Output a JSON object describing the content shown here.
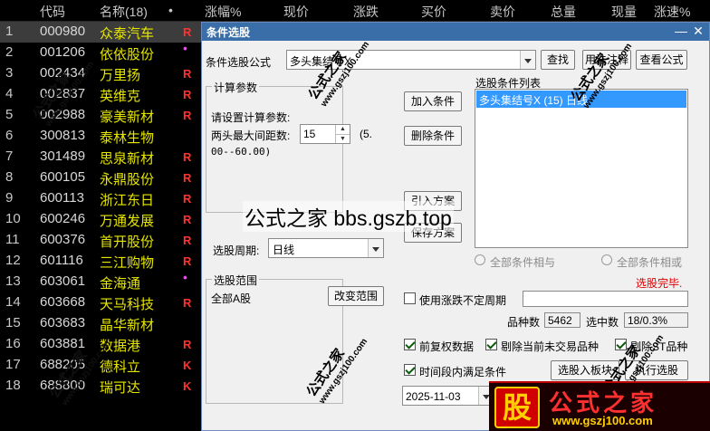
{
  "grid": {
    "headers": [
      "代码",
      "名称(18)",
      "•",
      "涨幅%",
      "现价",
      "涨跌",
      "买价",
      "卖价",
      "总量",
      "现量",
      "涨速%"
    ],
    "rows": [
      {
        "no": "1",
        "code": "000980",
        "name": "众泰汽车",
        "flag": "R"
      },
      {
        "no": "2",
        "code": "001206",
        "name": "依依股份",
        "flag": "•"
      },
      {
        "no": "3",
        "code": "002434",
        "name": "万里扬",
        "flag": "R"
      },
      {
        "no": "4",
        "code": "002837",
        "name": "英维克",
        "flag": "R"
      },
      {
        "no": "5",
        "code": "002988",
        "name": "豪美新材",
        "flag": "R"
      },
      {
        "no": "6",
        "code": "300813",
        "name": "泰林生物",
        "flag": ""
      },
      {
        "no": "7",
        "code": "301489",
        "name": "思泉新材",
        "flag": "R"
      },
      {
        "no": "8",
        "code": "600105",
        "name": "永鼎股份",
        "flag": "R"
      },
      {
        "no": "9",
        "code": "600113",
        "name": "浙江东日",
        "flag": "R"
      },
      {
        "no": "10",
        "code": "600246",
        "name": "万通发展",
        "flag": "R"
      },
      {
        "no": "11",
        "code": "600376",
        "name": "首开股份",
        "flag": "R"
      },
      {
        "no": "12",
        "code": "601116",
        "name": "三江购物",
        "flag": "R"
      },
      {
        "no": "13",
        "code": "603061",
        "name": "金海通",
        "flag": "•"
      },
      {
        "no": "14",
        "code": "603668",
        "name": "天马科技",
        "flag": "R"
      },
      {
        "no": "15",
        "code": "603683",
        "name": "晶华新材",
        "flag": ""
      },
      {
        "no": "16",
        "code": "603881",
        "name": "数据港",
        "flag": "R"
      },
      {
        "no": "17",
        "code": "688205",
        "name": "德科立",
        "flag": "K"
      },
      {
        "no": "18",
        "code": "688800",
        "name": "瑞可达",
        "flag": "K"
      }
    ]
  },
  "dialog": {
    "title": "条件选股",
    "formula_label": "条件选股公式",
    "formula_value": "多头集结号X",
    "find_button": "查找",
    "usage_button": "用法注释",
    "view_formula_button": "查看公式",
    "params_group": "计算参数",
    "params_prompt": "请设置计算参数:",
    "param_label": "两头最大间距数:",
    "param_value": "15",
    "param_range_1": "(5.",
    "param_range_2": "00--60.00)",
    "add_condition": "加入条件",
    "delete_condition": "删除条件",
    "import_plan": "引入方案",
    "save_plan": "保存方案",
    "condition_list_label": "选股条件列表",
    "condition_list_items": [
      "多头集结号X (15) 日线"
    ],
    "all_and": "全部条件相与",
    "all_or": "全部条件相或",
    "status_text": "选股完毕.",
    "period_label": "选股周期:",
    "period_value": "日线",
    "scope_group": "选股范围",
    "scope_value": "全部A股",
    "change_scope": "改变范围",
    "use_variable_period": "使用涨跌不定周期",
    "variety_count_label": "品种数",
    "variety_count_value": "5462",
    "selected_label": "选中数",
    "selected_value": "18/0.3%",
    "adj_data": "前复权数据",
    "exclude_untraded": "剔除当前未交易品种",
    "exclude_st": "剔除ST品种",
    "time_range_label": "时间段内满足条件",
    "date_value": "2025-11-03",
    "to_block_button": "选股入板块",
    "execute_button": "执行选股"
  },
  "watermark": {
    "center": "公式之家 bbs.gszb.top",
    "stamp_text": "公式之家",
    "stamp_url": "www.gszj100.com",
    "banner_badge": "股",
    "banner_title": "公式之家",
    "banner_url": "www.gszj100.com"
  },
  "colors": {
    "title_bar": "#3a6ea8",
    "selection": "#3399ff",
    "status_red": "#e00000",
    "stock_name": "#e6e600",
    "flag_red": "#ff3232"
  }
}
